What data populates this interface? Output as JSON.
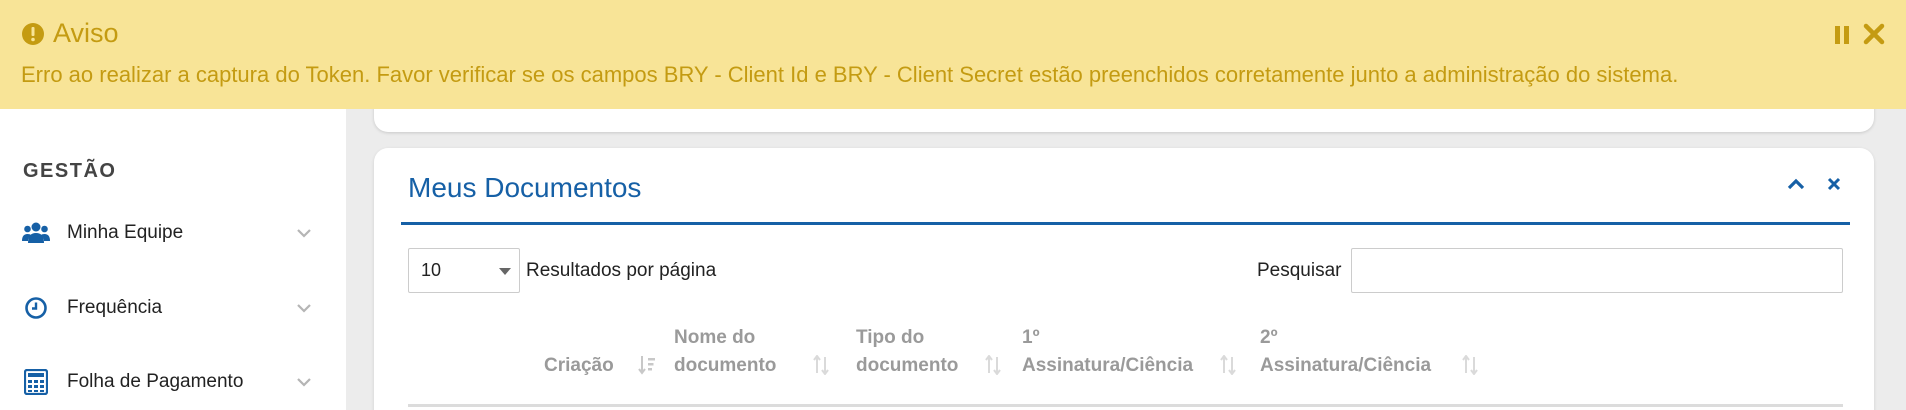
{
  "alert": {
    "title": "Aviso",
    "message": "Erro ao realizar a captura do Token. Favor verificar se os campos BRY - Client Id e BRY - Client Secret estão preenchidos corretamente junto a administração do sistema.",
    "icon": "exclamation-circle-icon",
    "color": "#c49b12",
    "background": "#f8e497"
  },
  "sidebar": {
    "heading": "GESTÃO",
    "items": [
      {
        "label": "Minha Equipe",
        "icon": "users-icon"
      },
      {
        "label": "Frequência",
        "icon": "clock-icon"
      },
      {
        "label": "Folha de Pagamento",
        "icon": "calculator-icon"
      }
    ]
  },
  "card": {
    "title": "Meus Documentos",
    "accent": "#1660a6",
    "length": {
      "value": "10",
      "label": "Resultados por página"
    },
    "search": {
      "label": "Pesquisar",
      "value": "",
      "placeholder": ""
    },
    "columns": [
      {
        "line1": "",
        "line2": "Criação"
      },
      {
        "line1": "Nome do",
        "line2": "documento"
      },
      {
        "line1": "Tipo do",
        "line2": "documento"
      },
      {
        "line1": "1º",
        "line2": "Assinatura/Ciência"
      },
      {
        "line1": "2º",
        "line2": "Assinatura/Ciência"
      }
    ]
  }
}
